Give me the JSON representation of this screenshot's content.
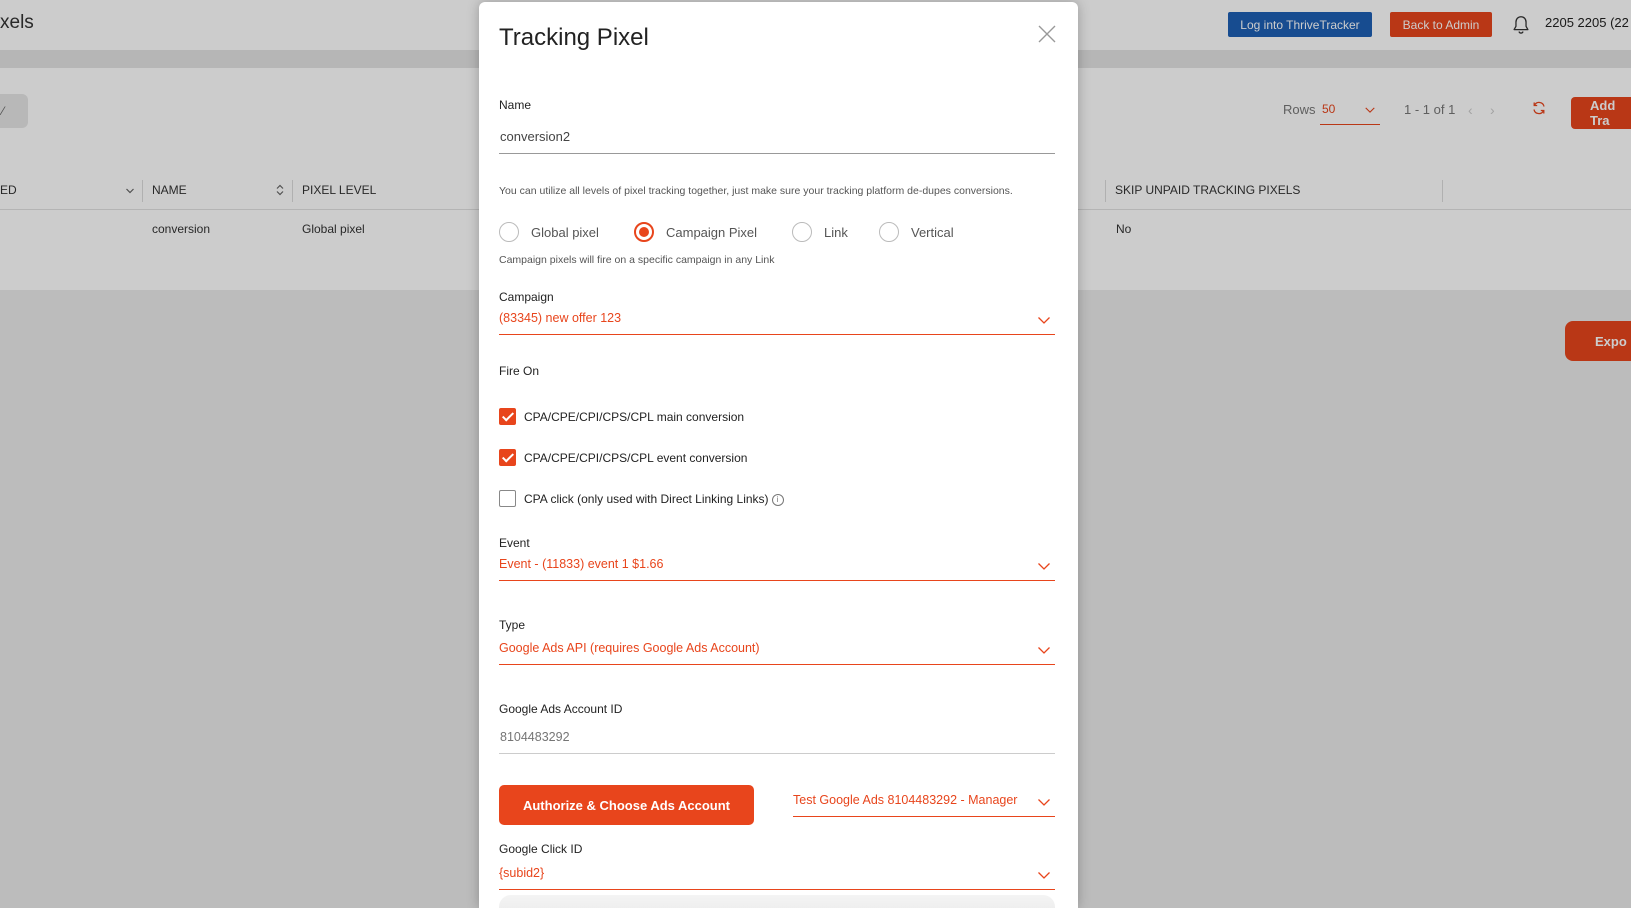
{
  "background": {
    "page_title": "xels",
    "header": {
      "thrive_button": "Log into ThriveTracker",
      "admin_button": "Back to Admin",
      "user_name": "2205 2205 (22"
    },
    "toolbar": {
      "pill_text": "⁄",
      "rows_label": "Rows",
      "rows_value": "50",
      "pager_text": "1 - 1 of 1",
      "prev_label": "‹",
      "next_label": "›",
      "add_button": "Add Tra"
    },
    "table": {
      "headers": [
        "ED",
        "NAME",
        "PIXEL LEVEL",
        "SKIP UNPAID TRACKING PIXELS"
      ],
      "row": [
        "conversion",
        "Global pixel",
        "No"
      ]
    },
    "export_button": "Expo"
  },
  "modal": {
    "title": "Tracking Pixel",
    "name_label": "Name",
    "name_value": "conversion2",
    "levels_hint": "You can utilize all levels of pixel tracking together, just make sure your tracking platform de-dupes conversions.",
    "levels": [
      {
        "label": "Global pixel",
        "selected": false
      },
      {
        "label": "Campaign Pixel",
        "selected": true
      },
      {
        "label": "Link",
        "selected": false
      },
      {
        "label": "Vertical",
        "selected": false
      }
    ],
    "level_hint": "Campaign pixels will fire on a specific campaign in any Link",
    "campaign_label": "Campaign",
    "campaign_value": "(83345) new offer 123",
    "fire_on_label": "Fire On",
    "fire_on": [
      {
        "label": "CPA/CPE/CPI/CPS/CPL main conversion",
        "checked": true
      },
      {
        "label": "CPA/CPE/CPI/CPS/CPL event conversion",
        "checked": true
      },
      {
        "label": "CPA click (only used with Direct Linking Links)",
        "checked": false
      }
    ],
    "info_glyph": "i",
    "event_label": "Event",
    "event_value": "Event - (11833) event 1 $1.66",
    "type_label": "Type",
    "type_value": "Google Ads API (requires Google Ads Account)",
    "gads_label": "Google Ads Account ID",
    "gads_placeholder": "8104483292",
    "auth_button": "Authorize & Choose Ads Account",
    "account_value": "Test Google Ads 8104483292 - Manager",
    "gclid_label": "Google Click ID",
    "gclid_value": "{subid2}"
  },
  "colors": {
    "accent": "#e8451c",
    "thrive_blue": "#1d5fb4"
  }
}
